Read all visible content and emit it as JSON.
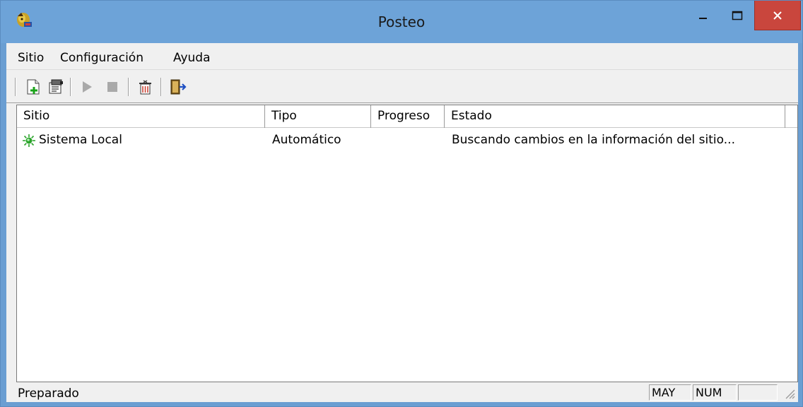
{
  "window": {
    "title": "Posteo"
  },
  "menu": [
    "Sitio",
    "Configuración",
    "Ayuda"
  ],
  "toolbar": {
    "buttons": [
      "new-site-icon",
      "properties-icon",
      "play-icon",
      "stop-icon",
      "delete-icon",
      "exit-icon"
    ]
  },
  "list": {
    "columns": [
      "Sitio",
      "Tipo",
      "Progreso",
      "Estado"
    ],
    "rows": [
      {
        "sitio": "Sistema Local",
        "tipo": "Automático",
        "progreso": "",
        "estado": "Buscando cambios en la información del sitio..."
      }
    ]
  },
  "status": {
    "text": "Preparado",
    "panels": [
      "MAY",
      "NUM",
      ""
    ]
  },
  "colors": {
    "titlebar": "#6da3d8",
    "close": "#c9463d",
    "client": "#f0f0f0"
  }
}
